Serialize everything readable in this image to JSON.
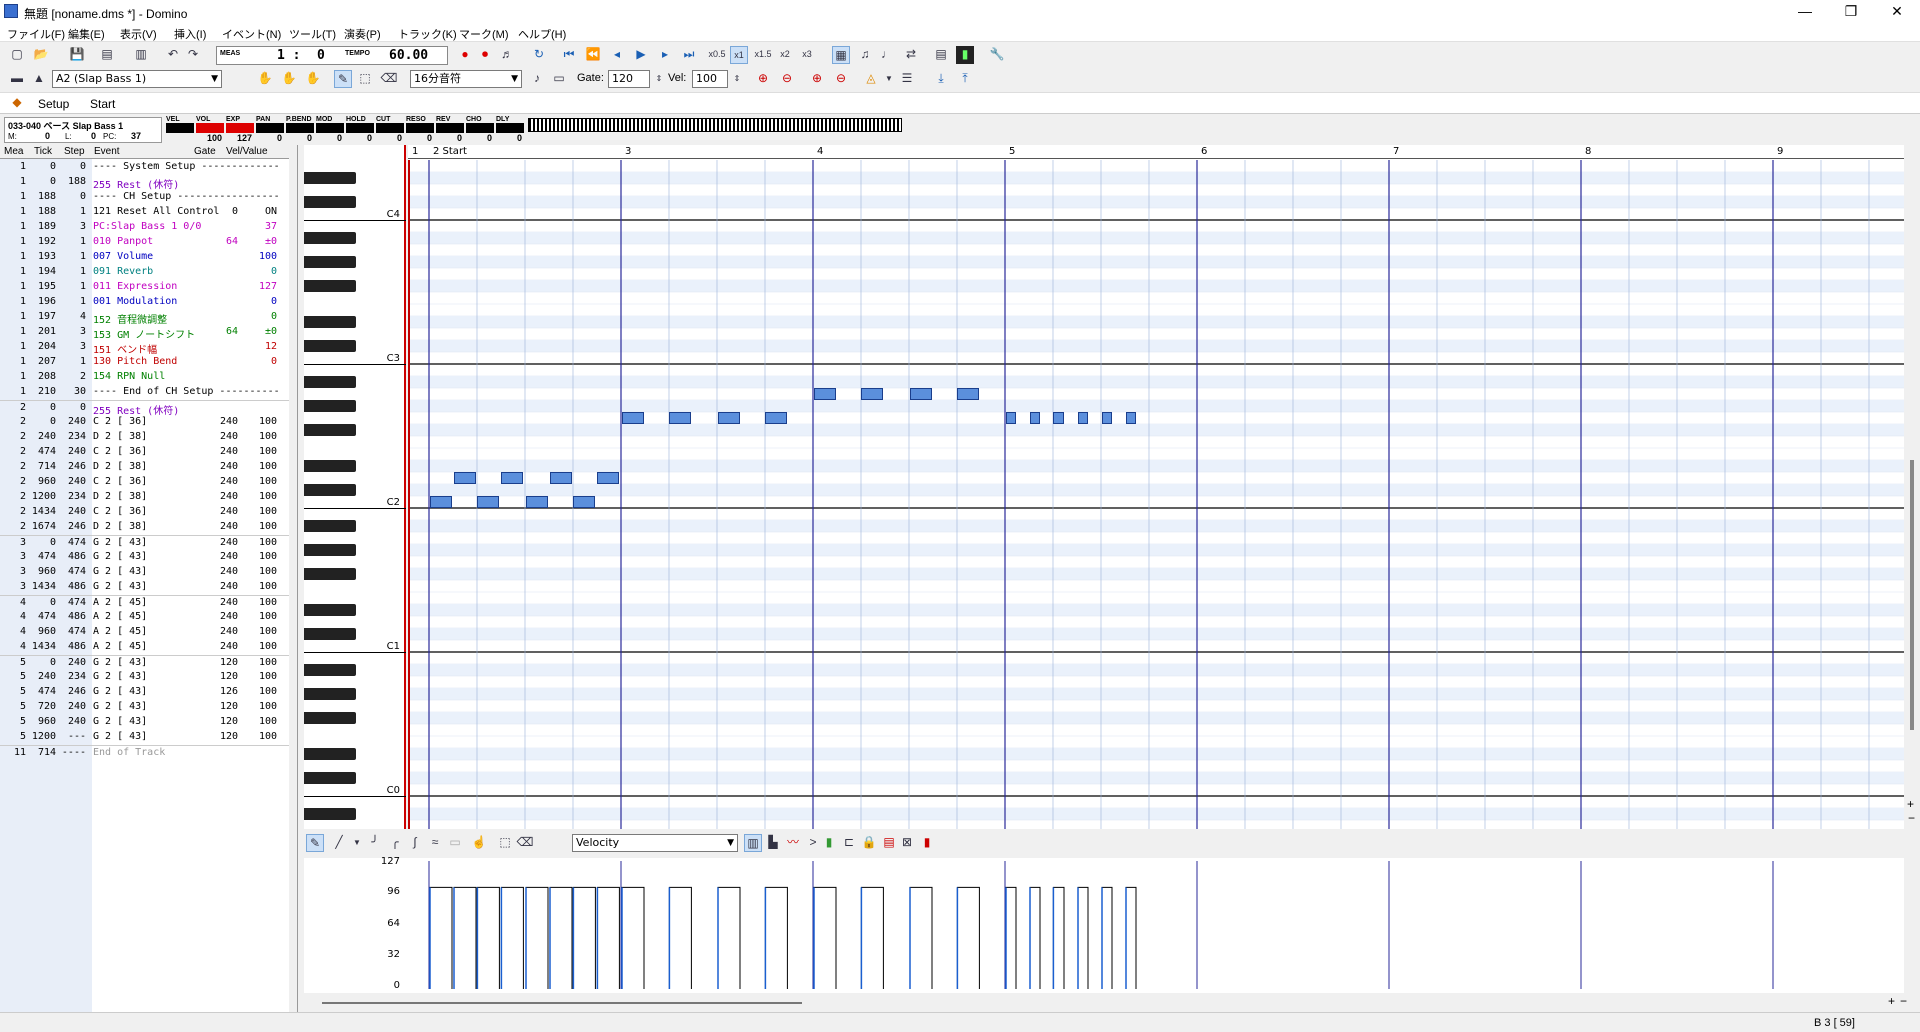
{
  "window": {
    "title": "無題 [noname.dms *] - Domino",
    "minimize": "—",
    "maximize": "❐",
    "close": "✕"
  },
  "menu": [
    "ファイル(F)",
    "編集(E)",
    "表示(V)",
    "挿入(I)",
    "イベント(N)",
    "ツール(T)",
    "演奏(P)",
    "トラック(K)",
    "マーク(M)",
    "ヘルプ(H)"
  ],
  "toolbar": {
    "meas_label": "MEAS",
    "meas_value": "1 :",
    "tick_value": "0",
    "tempo_label": "TEMPO",
    "tempo_value": "60.00",
    "zoom": [
      "x0.5",
      "x1",
      "x1.5",
      "x2",
      "x3"
    ]
  },
  "toolbar2": {
    "instrument": "A2  (Slap Bass 1)",
    "note_length": "16分音符",
    "gate_label": "Gate:",
    "gate_value": "120",
    "vel_label": "Vel:",
    "vel_value": "100"
  },
  "marks": {
    "setup": "Setup",
    "start": "Start"
  },
  "monitor": {
    "port": "033-040 ベース Slap Bass 1",
    "m_label": "M:",
    "m_value": "0",
    "l_label": "L:",
    "l_value": "0",
    "pc_label": "PC:",
    "pc_value": "37",
    "controls": [
      {
        "label": "VEL",
        "value": "",
        "fill": "#000"
      },
      {
        "label": "VOL",
        "value": "100",
        "fill": "#d00"
      },
      {
        "label": "EXP",
        "value": "127",
        "fill": "#d00"
      },
      {
        "label": "PAN",
        "value": "0",
        "fill": "#000"
      },
      {
        "label": "P.BEND",
        "value": "0",
        "fill": "#000"
      },
      {
        "label": "MOD",
        "value": "0",
        "fill": "#000"
      },
      {
        "label": "HOLD",
        "value": "0",
        "fill": "#000"
      },
      {
        "label": "CUT",
        "value": "0",
        "fill": "#000"
      },
      {
        "label": "RESO",
        "value": "0",
        "fill": "#000"
      },
      {
        "label": "REV",
        "value": "0",
        "fill": "#000"
      },
      {
        "label": "CHO",
        "value": "0",
        "fill": "#000"
      },
      {
        "label": "DLY",
        "value": "0",
        "fill": "#000"
      }
    ]
  },
  "list": {
    "headers": [
      "Mea",
      "Tick",
      "Step",
      "Event",
      "Gate",
      "Vel/Value"
    ],
    "rows": [
      {
        "mea": "1",
        "tick": "0",
        "step": "0",
        "ev": "---- System Setup -------------",
        "gate": "",
        "val": "",
        "color": "#000"
      },
      {
        "mea": "1",
        "tick": "0",
        "step": "188",
        "ev": "255 Rest (休符)",
        "gate": "",
        "val": "",
        "color": "#8000c0"
      },
      {
        "mea": "1",
        "tick": "188",
        "step": "0",
        "ev": "---- CH Setup -----------------",
        "gate": "",
        "val": "",
        "color": "#000"
      },
      {
        "mea": "1",
        "tick": "188",
        "step": "1",
        "ev": "121 Reset All Control",
        "gate": "0",
        "val": "ON",
        "color": "#000"
      },
      {
        "mea": "1",
        "tick": "189",
        "step": "3",
        "ev": "PC:Slap Bass 1  0/0",
        "gate": "",
        "val": "37",
        "color": "#c000c0"
      },
      {
        "mea": "1",
        "tick": "192",
        "step": "1",
        "ev": "010 Panpot",
        "gate": "64",
        "val": "±0",
        "color": "#c000c0"
      },
      {
        "mea": "1",
        "tick": "193",
        "step": "1",
        "ev": "007 Volume",
        "gate": "",
        "val": "100",
        "color": "#0000c0"
      },
      {
        "mea": "1",
        "tick": "194",
        "step": "1",
        "ev": "091 Reverb",
        "gate": "",
        "val": "0",
        "color": "#008080"
      },
      {
        "mea": "1",
        "tick": "195",
        "step": "1",
        "ev": "011 Expression",
        "gate": "",
        "val": "127",
        "color": "#c000c0"
      },
      {
        "mea": "1",
        "tick": "196",
        "step": "1",
        "ev": "001 Modulation",
        "gate": "",
        "val": "0",
        "color": "#0000c0"
      },
      {
        "mea": "1",
        "tick": "197",
        "step": "4",
        "ev": "152 音程微調整",
        "gate": "",
        "val": "0",
        "color": "#008000"
      },
      {
        "mea": "1",
        "tick": "201",
        "step": "3",
        "ev": "153 GM ノートシフト",
        "gate": "64",
        "val": "±0",
        "color": "#008000"
      },
      {
        "mea": "1",
        "tick": "204",
        "step": "3",
        "ev": "151 ベンド幅",
        "gate": "",
        "val": "12",
        "color": "#c00000"
      },
      {
        "mea": "1",
        "tick": "207",
        "step": "1",
        "ev": "130 Pitch Bend",
        "gate": "",
        "val": "0",
        "color": "#c00000"
      },
      {
        "mea": "1",
        "tick": "208",
        "step": "2",
        "ev": "154 RPN Null",
        "gate": "",
        "val": "",
        "color": "#008000"
      },
      {
        "mea": "1",
        "tick": "210",
        "step": "30",
        "ev": "---- End of CH Setup ----------",
        "gate": "",
        "val": "",
        "color": "#000"
      },
      {
        "mea": "2",
        "tick": "0",
        "step": "0",
        "ev": "255 Rest (休符)",
        "gate": "",
        "val": "",
        "color": "#8000c0"
      },
      {
        "mea": "2",
        "tick": "0",
        "step": "240",
        "ev": "C  2 [ 36]",
        "gate": "240",
        "val": "100",
        "color": "#000"
      },
      {
        "mea": "2",
        "tick": "240",
        "step": "234",
        "ev": "D  2 [ 38]",
        "gate": "240",
        "val": "100",
        "color": "#000"
      },
      {
        "mea": "2",
        "tick": "474",
        "step": "240",
        "ev": "C  2 [ 36]",
        "gate": "240",
        "val": "100",
        "color": "#000"
      },
      {
        "mea": "2",
        "tick": "714",
        "step": "246",
        "ev": "D  2 [ 38]",
        "gate": "240",
        "val": "100",
        "color": "#000"
      },
      {
        "mea": "2",
        "tick": "960",
        "step": "240",
        "ev": "C  2 [ 36]",
        "gate": "240",
        "val": "100",
        "color": "#000"
      },
      {
        "mea": "2",
        "tick": "1200",
        "step": "234",
        "ev": "D  2 [ 38]",
        "gate": "240",
        "val": "100",
        "color": "#000"
      },
      {
        "mea": "2",
        "tick": "1434",
        "step": "240",
        "ev": "C  2 [ 36]",
        "gate": "240",
        "val": "100",
        "color": "#000"
      },
      {
        "mea": "2",
        "tick": "1674",
        "step": "246",
        "ev": "D  2 [ 38]",
        "gate": "240",
        "val": "100",
        "color": "#000"
      },
      {
        "mea": "3",
        "tick": "0",
        "step": "474",
        "ev": "G  2 [ 43]",
        "gate": "240",
        "val": "100",
        "color": "#000"
      },
      {
        "mea": "3",
        "tick": "474",
        "step": "486",
        "ev": "G  2 [ 43]",
        "gate": "240",
        "val": "100",
        "color": "#000"
      },
      {
        "mea": "3",
        "tick": "960",
        "step": "474",
        "ev": "G  2 [ 43]",
        "gate": "240",
        "val": "100",
        "color": "#000"
      },
      {
        "mea": "3",
        "tick": "1434",
        "step": "486",
        "ev": "G  2 [ 43]",
        "gate": "240",
        "val": "100",
        "color": "#000"
      },
      {
        "mea": "4",
        "tick": "0",
        "step": "474",
        "ev": "A  2 [ 45]",
        "gate": "240",
        "val": "100",
        "color": "#000"
      },
      {
        "mea": "4",
        "tick": "474",
        "step": "486",
        "ev": "A  2 [ 45]",
        "gate": "240",
        "val": "100",
        "color": "#000"
      },
      {
        "mea": "4",
        "tick": "960",
        "step": "474",
        "ev": "A  2 [ 45]",
        "gate": "240",
        "val": "100",
        "color": "#000"
      },
      {
        "mea": "4",
        "tick": "1434",
        "step": "486",
        "ev": "A  2 [ 45]",
        "gate": "240",
        "val": "100",
        "color": "#000"
      },
      {
        "mea": "5",
        "tick": "0",
        "step": "240",
        "ev": "G  2 [ 43]",
        "gate": "120",
        "val": "100",
        "color": "#000"
      },
      {
        "mea": "5",
        "tick": "240",
        "step": "234",
        "ev": "G  2 [ 43]",
        "gate": "120",
        "val": "100",
        "color": "#000"
      },
      {
        "mea": "5",
        "tick": "474",
        "step": "246",
        "ev": "G  2 [ 43]",
        "gate": "126",
        "val": "100",
        "color": "#000"
      },
      {
        "mea": "5",
        "tick": "720",
        "step": "240",
        "ev": "G  2 [ 43]",
        "gate": "120",
        "val": "100",
        "color": "#000"
      },
      {
        "mea": "5",
        "tick": "960",
        "step": "240",
        "ev": "G  2 [ 43]",
        "gate": "120",
        "val": "100",
        "color": "#000"
      },
      {
        "mea": "5",
        "tick": "1200",
        "step": "---",
        "ev": "G  2 [ 43]",
        "gate": "120",
        "val": "100",
        "color": "#000"
      },
      {
        "mea": "11",
        "tick": "714",
        "step": "----",
        "ev": "End of Track",
        "gate": "",
        "val": "",
        "color": "#999"
      }
    ]
  },
  "ruler": {
    "labels": [
      "1",
      "2 Start",
      "3",
      "4",
      "5",
      "6",
      "7",
      "8",
      "9"
    ]
  },
  "keys": {
    "labels": [
      "C4",
      "C3",
      "C2",
      "C1",
      "C0"
    ]
  },
  "notes": [
    {
      "mea": 2,
      "tick": 0,
      "pitch": 36
    },
    {
      "mea": 2,
      "tick": 240,
      "pitch": 38
    },
    {
      "mea": 2,
      "tick": 474,
      "pitch": 36
    },
    {
      "mea": 2,
      "tick": 714,
      "pitch": 38
    },
    {
      "mea": 2,
      "tick": 960,
      "pitch": 36
    },
    {
      "mea": 2,
      "tick": 1200,
      "pitch": 38
    },
    {
      "mea": 2,
      "tick": 1434,
      "pitch": 36
    },
    {
      "mea": 2,
      "tick": 1674,
      "pitch": 38
    },
    {
      "mea": 3,
      "tick": 0,
      "pitch": 43
    },
    {
      "mea": 3,
      "tick": 474,
      "pitch": 43
    },
    {
      "mea": 3,
      "tick": 960,
      "pitch": 43
    },
    {
      "mea": 3,
      "tick": 1434,
      "pitch": 43
    },
    {
      "mea": 4,
      "tick": 0,
      "pitch": 45
    },
    {
      "mea": 4,
      "tick": 474,
      "pitch": 45
    },
    {
      "mea": 4,
      "tick": 960,
      "pitch": 45
    },
    {
      "mea": 4,
      "tick": 1434,
      "pitch": 45
    },
    {
      "mea": 5,
      "tick": 0,
      "pitch": 43
    },
    {
      "mea": 5,
      "tick": 240,
      "pitch": 43
    },
    {
      "mea": 5,
      "tick": 474,
      "pitch": 43
    },
    {
      "mea": 5,
      "tick": 720,
      "pitch": 43
    },
    {
      "mea": 5,
      "tick": 960,
      "pitch": 43
    },
    {
      "mea": 5,
      "tick": 1200,
      "pitch": 43
    }
  ],
  "velocity": {
    "mode": "Velocity",
    "labels": [
      "127",
      "96",
      "64",
      "32",
      "0"
    ],
    "value": 100
  },
  "status": {
    "position": "B 3 [ 59]"
  },
  "colors": {
    "measure_line": "#2a2a9a",
    "beat_line": "#9ab0d8",
    "note_fill": "#5b8fdc",
    "playhead": "#c00000"
  }
}
